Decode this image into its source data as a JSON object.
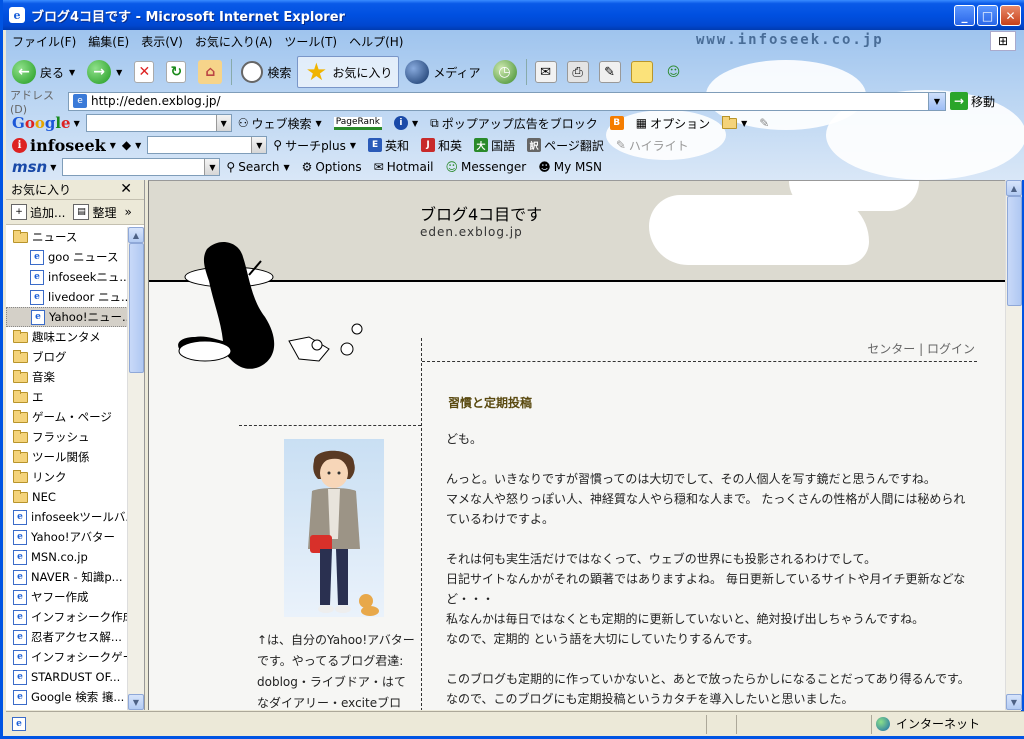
{
  "window": {
    "title": "ブログ4コ目です - Microsoft Internet Explorer",
    "minimize": "_",
    "maximize": "□",
    "close": "✕"
  },
  "menu": [
    "ファイル(F)",
    "編集(E)",
    "表示(V)",
    "お気に入り(A)",
    "ツール(T)",
    "ヘルプ(H)"
  ],
  "branding": "www.infoseek.co.jp",
  "toolbar": {
    "back": "戻る",
    "search": "検索",
    "favorites": "お気に入り",
    "media": "メディア"
  },
  "address": {
    "label": "アドレス(D)",
    "url": "http://eden.exblog.jp/",
    "go": "移動"
  },
  "google_bar": {
    "web_search": "ウェブ検索",
    "pagerank": "PageRank",
    "popup_block": "ポップアップ広告をブロック",
    "options": "オプション"
  },
  "infoseek_bar": {
    "logo": "infoseek",
    "search_plus": "サーチplus",
    "en_ja": "英和",
    "ja_en": "和英",
    "kokugo": "国語",
    "page_translate": "ページ翻訳",
    "highlight": "ハイライト"
  },
  "msn_bar": {
    "logo": "msn",
    "search": "Search",
    "options": "Options",
    "hotmail": "Hotmail",
    "messenger": "Messenger",
    "mymsn": "My MSN"
  },
  "favorites_pane": {
    "title": "お気に入り",
    "close": "✕",
    "add": "追加...",
    "organize": "整理",
    "more": "»",
    "items": [
      {
        "label": "ニュース",
        "type": "folder",
        "level": "top"
      },
      {
        "label": "goo ニュース",
        "type": "page",
        "level": "sub"
      },
      {
        "label": "infoseekニュ...",
        "type": "page",
        "level": "sub"
      },
      {
        "label": "livedoor ニュ...",
        "type": "page",
        "level": "sub"
      },
      {
        "label": "Yahoo!ニュー...",
        "type": "page",
        "level": "sub",
        "selected": true
      },
      {
        "label": "趣味エンタメ",
        "type": "folder",
        "level": "top"
      },
      {
        "label": "ブログ",
        "type": "folder",
        "level": "top"
      },
      {
        "label": "音楽",
        "type": "folder",
        "level": "top"
      },
      {
        "label": "エ",
        "type": "folder",
        "level": "top"
      },
      {
        "label": "ゲーム・ページ",
        "type": "folder",
        "level": "top"
      },
      {
        "label": "フラッシュ",
        "type": "folder",
        "level": "top"
      },
      {
        "label": "ツール関係",
        "type": "folder",
        "level": "top"
      },
      {
        "label": "リンク",
        "type": "folder",
        "level": "top"
      },
      {
        "label": "NEC",
        "type": "folder",
        "level": "top"
      },
      {
        "label": "infoseekツールバ...",
        "type": "page",
        "level": "top"
      },
      {
        "label": "Yahoo!アバター",
        "type": "page",
        "level": "top"
      },
      {
        "label": "MSN.co.jp",
        "type": "page",
        "level": "top"
      },
      {
        "label": "NAVER - 知識p...",
        "type": "page",
        "level": "top"
      },
      {
        "label": "ヤフー作成",
        "type": "page",
        "level": "top"
      },
      {
        "label": "インフォシーク作成",
        "type": "page",
        "level": "top"
      },
      {
        "label": "忍者アクセス解...",
        "type": "page",
        "level": "top"
      },
      {
        "label": "インフォシークゲー...",
        "type": "page",
        "level": "top"
      },
      {
        "label": "STARDUST OF...",
        "type": "page",
        "level": "top"
      },
      {
        "label": "Google 検索 攘...",
        "type": "page",
        "level": "top"
      }
    ]
  },
  "blog": {
    "title": "ブログ4コ目です",
    "url": "eden.exblog.jp",
    "link_center": "センター",
    "link_sep": "|",
    "link_login": "ログイン",
    "post_title": "習慣と定期投稿",
    "paragraphs": [
      "ども。",
      "",
      "んっと。いきなりですが習慣ってのは大切でして、その人個人を写す鏡だと思うんですね。",
      "マメな人や怒りっぽい人、神経質な人やら穏和な人まで。 たっくさんの性格が人間には秘められているわけですよ。",
      "",
      "それは何も実生活だけではなくって、ウェブの世界にも投影されるわけでして。",
      "日記サイトなんかがそれの顕著ではありますよね。 毎日更新しているサイトや月イチ更新などなど・・・",
      "私なんかは毎日ではなくとも定期的に更新していないと、絶対投げ出しちゃうんですね。",
      "なので、定期的 という語を大切にしていたりするんです。",
      "",
      "このブログも定期的に作っていかないと、あとで放ったらかしになることだってあり得るんです。",
      "なので、このブログにも定期投稿というカタチを導入したいと思いました。"
    ],
    "side_text": "↑は、自分のYahoo!アバターです。やってるブログ君達: doblog・ライブドア・はてなダイアリー・exciteブロ"
  },
  "status": {
    "zone": "インターネット"
  }
}
